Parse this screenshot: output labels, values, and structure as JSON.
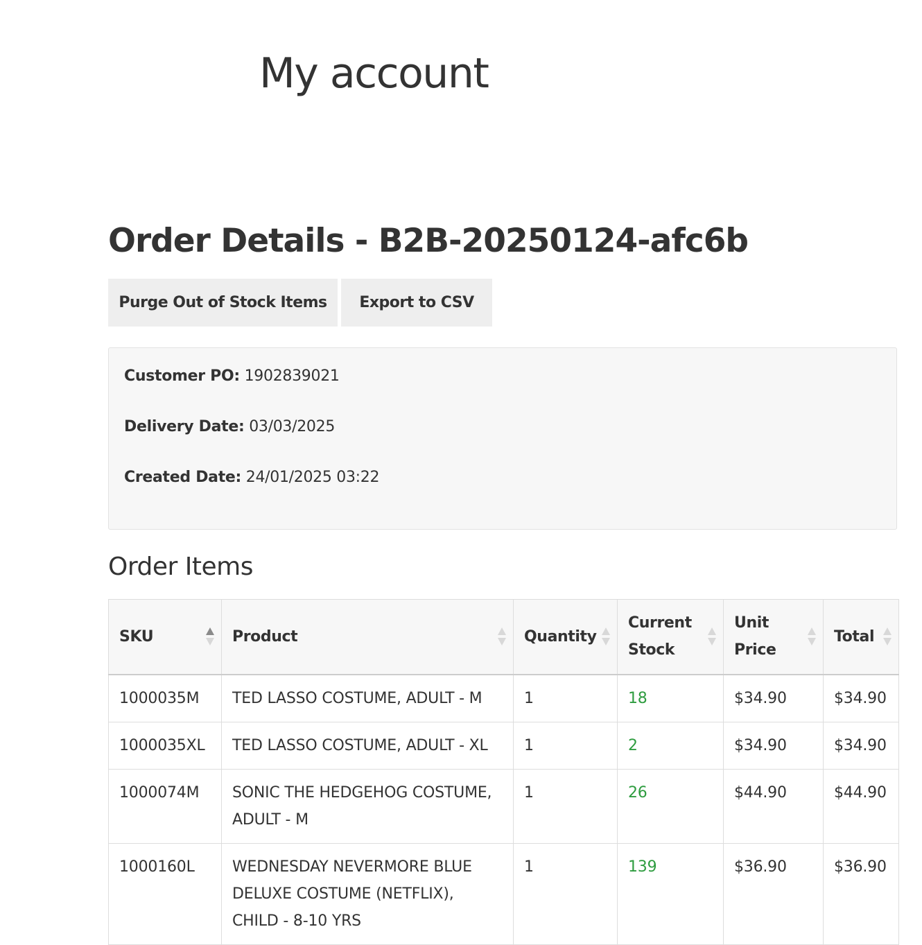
{
  "page": {
    "title": "My account"
  },
  "order": {
    "heading": "Order Details - B2B-20250124-afc6b",
    "actions": {
      "purge_label": "Purge Out of Stock Items",
      "export_label": "Export to CSV"
    },
    "info": {
      "po_label": "Customer PO:",
      "po_value": " 1902839021",
      "delivery_label": "Delivery Date:",
      "delivery_value": " 03/03/2025",
      "created_label": "Created Date:",
      "created_value": " 24/01/2025 03:22"
    }
  },
  "items": {
    "heading": "Order Items",
    "columns": [
      "SKU",
      "Product",
      "Quantity",
      "Current Stock",
      "Unit Price",
      "Total"
    ],
    "sorted_column": "SKU",
    "rows": [
      {
        "sku": "1000035M",
        "product": "TED LASSO COSTUME, ADULT - M",
        "quantity": "1",
        "stock": "18",
        "unit_price": "$34.90",
        "total": "$34.90"
      },
      {
        "sku": "1000035XL",
        "product": "TED LASSO COSTUME, ADULT - XL",
        "quantity": "1",
        "stock": "2",
        "unit_price": "$34.90",
        "total": "$34.90"
      },
      {
        "sku": "1000074M",
        "product": "SONIC THE HEDGEHOG COSTUME, ADULT - M",
        "quantity": "1",
        "stock": "26",
        "unit_price": "$44.90",
        "total": "$44.90"
      },
      {
        "sku": "1000160L",
        "product": "WEDNESDAY NEVERMORE BLUE DELUXE COSTUME (NETFLIX), CHILD - 8-10 YRS",
        "quantity": "1",
        "stock": "139",
        "unit_price": "$36.90",
        "total": "$36.90"
      }
    ]
  },
  "colors": {
    "stock_in": "#2e9c3f",
    "button_bg": "#eeeeee",
    "panel_bg": "#f7f7f7",
    "text": "#333333"
  },
  "icons": {
    "sort": "sort-arrows-icon"
  }
}
